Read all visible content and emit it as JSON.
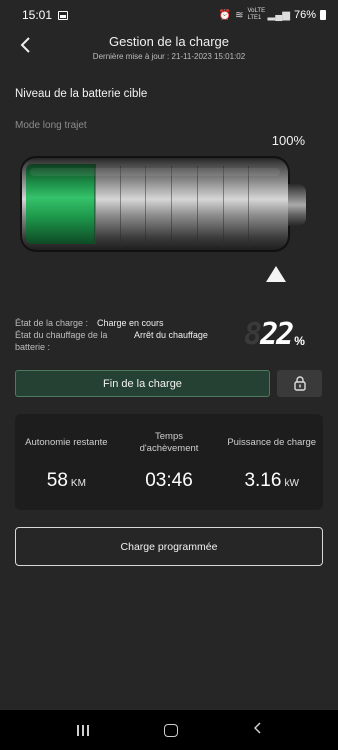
{
  "status_bar": {
    "time": "15:01",
    "network": "VoLTE LTE1",
    "battery": "76%"
  },
  "header": {
    "title": "Gestion de la charge",
    "subtitle": "Dernière mise à jour : 21-11-2023 15:01:02"
  },
  "battery_section": {
    "title": "Niveau de la batterie cible",
    "mode": "Mode long trajet",
    "target_percent": "100%",
    "current_level_fraction": 0.22,
    "target_level_fraction": 1.0
  },
  "charge_status": {
    "state_label": "État de la charge :",
    "state_value": "Charge en cours",
    "heating_label_line1": "État du chauffage de la",
    "heating_label_line2": "batterie :",
    "heating_value": "Arrêt du chauffage",
    "level_ghost": "8",
    "level_value": "22",
    "level_unit": "%"
  },
  "actions": {
    "stop_label": "Fin de la charge",
    "scheduled_label": "Charge programmée"
  },
  "stats": [
    {
      "label": "Autonomie restante",
      "value": "58",
      "unit": "KM"
    },
    {
      "label": "Temps\nd'achèvement",
      "value": "03:46",
      "unit": ""
    },
    {
      "label": "Puissance de charge",
      "value": "3.16",
      "unit": "kW"
    }
  ],
  "colors": {
    "background": "#262626",
    "accent_green": "#35c26a",
    "stop_button_bg": "#254133"
  }
}
